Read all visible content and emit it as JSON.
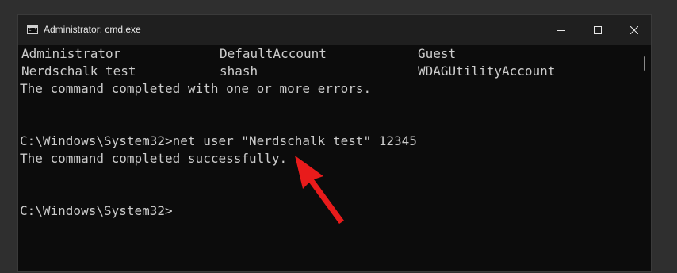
{
  "window": {
    "title": "Administrator: cmd.exe",
    "icon": "cmd-icon",
    "icon_glyph": "C:\\"
  },
  "controls": {
    "minimize_icon": "minimize-icon",
    "maximize_icon": "maximize-icon",
    "close_icon": "close-icon"
  },
  "console": {
    "user_rows": [
      [
        "Administrator",
        "DefaultAccount",
        "Guest"
      ],
      [
        "Nerdschalk test",
        "shash",
        "WDAGUtilityAccount"
      ]
    ],
    "lines": [
      "The command completed with one or more errors.",
      "",
      "",
      "C:\\Windows\\System32>net user \"Nerdschalk test\" 12345",
      "The command completed successfully.",
      "",
      "",
      "C:\\Windows\\System32>"
    ]
  },
  "colors": {
    "background": "#0c0c0c",
    "text": "#cccccc",
    "annotation_arrow": "#e81b1b"
  }
}
